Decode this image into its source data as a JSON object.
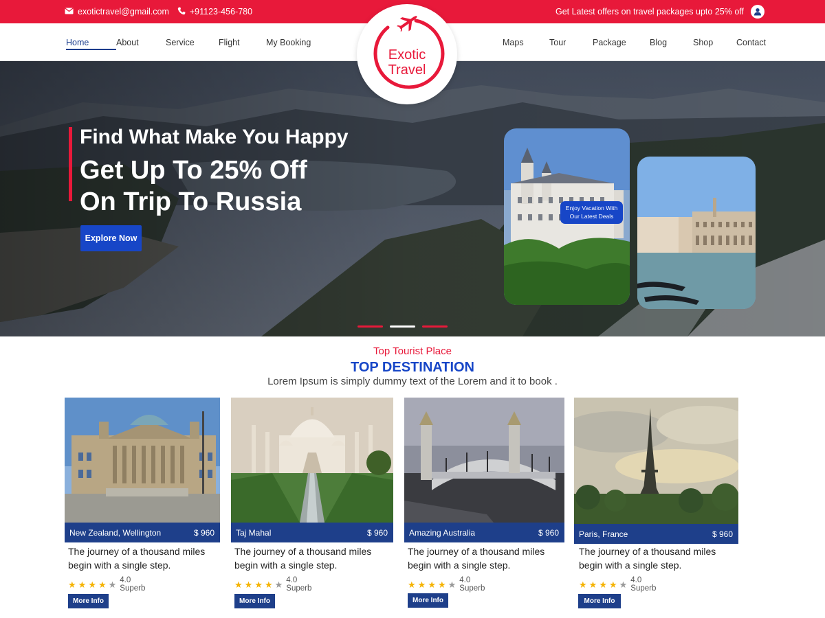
{
  "topbar": {
    "email": "exotictravel@gmail.com",
    "phone": "+91123-456-780",
    "offer": "Get Latest offers on travel packages upto 25% off"
  },
  "nav": {
    "left": [
      "Home",
      "About",
      "Service",
      "Flight",
      "My Booking"
    ],
    "right": [
      "Maps",
      "Tour",
      "Package",
      "Blog",
      "Shop",
      "Contact"
    ],
    "active": "Home"
  },
  "logo": {
    "line1": "Exotic",
    "line2": "Travel"
  },
  "hero": {
    "subtitle": "Find What Make You Happy",
    "title_line1": "Get Up To 25% Off",
    "title_line2": "On Trip To Russia",
    "button": "Explore Now",
    "badge_line1": "Enjoy Vacation With",
    "badge_line2": "Our Latest Deals",
    "slide_count": 3,
    "active_slide": 2
  },
  "section": {
    "kicker": "Top Tourist Place",
    "title": "TOP DESTINATION",
    "description": "Lorem Ipsum is simply dummy text of the Lorem  and  it to book ."
  },
  "destinations": [
    {
      "name": "New Zealand, Wellington",
      "price": "$ 960",
      "desc": "The journey of a thousand miles begin with a single step.",
      "rating": "4.0 Superb",
      "stars": 4,
      "button": "More Info"
    },
    {
      "name": "Taj Mahal",
      "price": "$ 960",
      "desc": "The journey of a thousand miles begin with a single step.",
      "rating": "4.0 Superb",
      "stars": 4,
      "button": "More Info"
    },
    {
      "name": "Amazing Australia",
      "price": "$ 960",
      "desc": "The journey of a thousand miles begin with a single step.",
      "rating": "4.0 Superb",
      "stars": 4,
      "button": "More Info"
    },
    {
      "name": "Paris, France",
      "price": "$ 960",
      "desc": "The journey of a thousand miles begin with a single step.",
      "rating": "4.0 Superb",
      "stars": 4,
      "button": "More Info"
    }
  ],
  "colors": {
    "brand_red": "#e8193a",
    "brand_blue": "#1746c7",
    "card_blue": "#1e3f8a"
  }
}
